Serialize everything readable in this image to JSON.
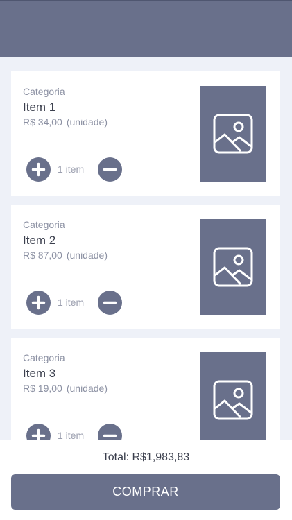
{
  "header": {
    "title": ""
  },
  "colors": {
    "accent": "#69708b",
    "background": "#eef1f8",
    "card": "#ffffff"
  },
  "items": [
    {
      "category": "Categoria",
      "name": "Item 1",
      "price": "R$ 34,00",
      "unit": "(unidade)",
      "quantity": "1 item",
      "image_icon": "image-placeholder-icon"
    },
    {
      "category": "Categoria",
      "name": "Item 2",
      "price": "R$ 87,00",
      "unit": "(unidade)",
      "quantity": "1 item",
      "image_icon": "image-placeholder-icon"
    },
    {
      "category": "Categoria",
      "name": "Item 3",
      "price": "R$ 19,00",
      "unit": "(unidade)",
      "quantity": "1 item",
      "image_icon": "image-placeholder-icon"
    }
  ],
  "footer": {
    "total": "Total: R$1,983,83",
    "buy_label": "COMPRAR"
  }
}
